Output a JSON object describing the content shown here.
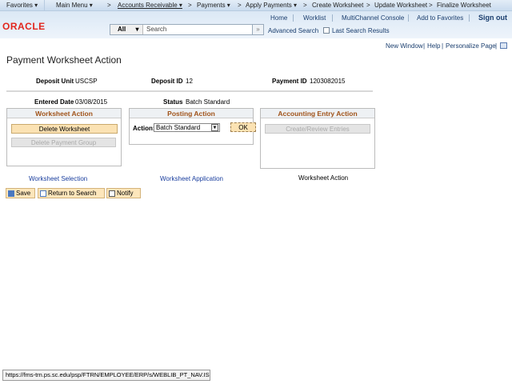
{
  "nav": {
    "items": [
      "Favorites ▾",
      "Main Menu ▾",
      ">",
      "Accounts Receivable ▾",
      ">",
      "Payments ▾",
      ">",
      "Apply Payments ▾",
      ">",
      "Create Worksheet",
      ">",
      "Update Worksheet",
      ">",
      "Finalize Worksheet"
    ]
  },
  "header": {
    "links": [
      "Home",
      "Worklist",
      "MultiChannel Console",
      "Add to Favorites",
      "Sign out"
    ],
    "logo": "ORACLE",
    "search_scope": "All",
    "search_placeholder": "Search",
    "advanced_search": "Advanced Search",
    "last_results": "Last Search Results"
  },
  "pagebar": {
    "new_window": "New Window",
    "help": "Help",
    "personalize": "Personalize Page"
  },
  "page": {
    "title": "Payment Worksheet Action",
    "deposit_unit_label": "Deposit Unit",
    "deposit_unit": "USCSP",
    "deposit_id_label": "Deposit ID",
    "deposit_id": "12",
    "payment_id_label": "Payment ID",
    "payment_id": "1203082015",
    "entered_date_label": "Entered Date",
    "entered_date": "03/08/2015",
    "status_label": "Status",
    "status": "Batch Standard"
  },
  "worksheet_action": {
    "title": "Worksheet Action",
    "delete_ws": "Delete Worksheet",
    "delete_pg": "Delete Payment Group"
  },
  "posting_action": {
    "title": "Posting Action",
    "action_label": "Action:",
    "action_value": "Batch Standard",
    "ok": "OK"
  },
  "accounting": {
    "title": "Accounting Entry Action",
    "create": "Create/Review Entries"
  },
  "links": {
    "ws_selection": "Worksheet Selection",
    "ws_application": "Worksheet Application",
    "ws_action": "Worksheet Action"
  },
  "toolbar": {
    "save": "Save",
    "return": "Return to Search",
    "notify": "Notify"
  },
  "statusbar": {
    "url": "https://fms-trn.ps.sc.edu/psp/FTRN/EMPLOYEE/ERP/s/WEBLIB_PT_NAV.IS..."
  }
}
